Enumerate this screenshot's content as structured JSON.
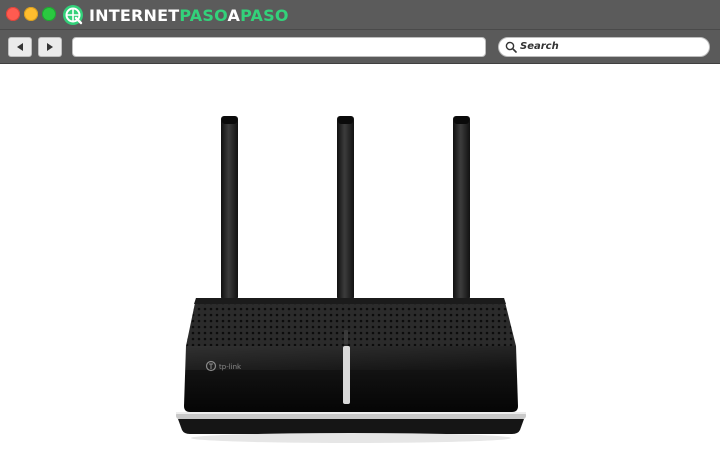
{
  "window": {
    "controls": [
      "close",
      "minimize",
      "maximize"
    ]
  },
  "brand": {
    "logo_icon": "globe-logo-icon",
    "logo_part1": "INTERNET",
    "logo_part2": "PASO",
    "logo_part3": "A",
    "logo_part4": "PASO",
    "accent": "#33d17a"
  },
  "toolbar": {
    "back_icon": "back-arrow-icon",
    "forward_icon": "forward-arrow-icon",
    "url": "",
    "search_icon": "search-icon",
    "search_placeholder": "Search"
  },
  "content": {
    "image": "tp-link router with three antennas",
    "router_brand": "tp-link"
  }
}
